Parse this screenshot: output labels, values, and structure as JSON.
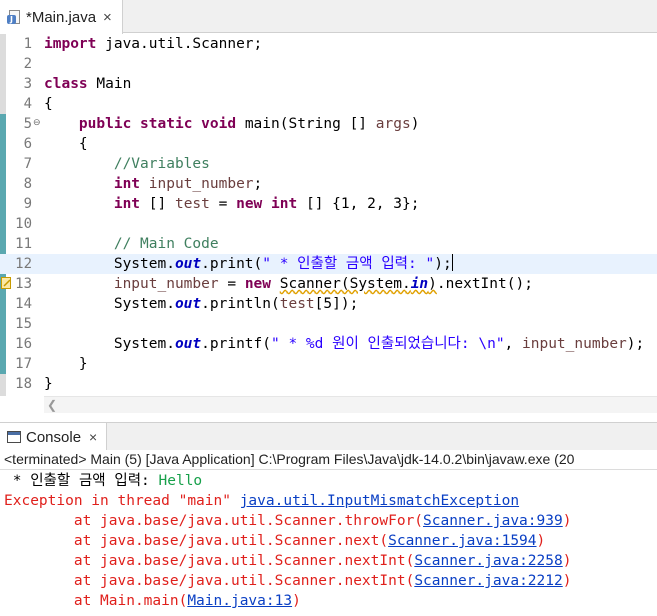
{
  "editor_tab": {
    "label": "*Main.java",
    "close": "×",
    "icon": "java-file-icon"
  },
  "code_lines": [
    {
      "num": "1",
      "parts": [
        {
          "t": "import",
          "c": "kw"
        },
        {
          "t": " java.util.Scanner;",
          "c": ""
        }
      ]
    },
    {
      "num": "2",
      "parts": []
    },
    {
      "num": "3",
      "parts": [
        {
          "t": "class",
          "c": "kw"
        },
        {
          "t": " Main",
          "c": ""
        }
      ]
    },
    {
      "num": "4",
      "parts": [
        {
          "t": "{",
          "c": ""
        }
      ]
    },
    {
      "num": "5",
      "parts": [
        {
          "t": "    ",
          "c": ""
        },
        {
          "t": "public",
          "c": "kw"
        },
        {
          "t": " ",
          "c": ""
        },
        {
          "t": "static",
          "c": "kw"
        },
        {
          "t": " ",
          "c": ""
        },
        {
          "t": "void",
          "c": "kw"
        },
        {
          "t": " main(String [] ",
          "c": ""
        },
        {
          "t": "args",
          "c": "var"
        },
        {
          "t": ")",
          "c": ""
        }
      ]
    },
    {
      "num": "6",
      "parts": [
        {
          "t": "    {",
          "c": ""
        }
      ]
    },
    {
      "num": "7",
      "parts": [
        {
          "t": "        ",
          "c": ""
        },
        {
          "t": "//Variables",
          "c": "cm"
        }
      ]
    },
    {
      "num": "8",
      "parts": [
        {
          "t": "        ",
          "c": ""
        },
        {
          "t": "int",
          "c": "kw"
        },
        {
          "t": " ",
          "c": ""
        },
        {
          "t": "input_number",
          "c": "var"
        },
        {
          "t": ";",
          "c": ""
        }
      ]
    },
    {
      "num": "9",
      "parts": [
        {
          "t": "        ",
          "c": ""
        },
        {
          "t": "int",
          "c": "kw"
        },
        {
          "t": " [] ",
          "c": ""
        },
        {
          "t": "test",
          "c": "var"
        },
        {
          "t": " = ",
          "c": ""
        },
        {
          "t": "new",
          "c": "kw"
        },
        {
          "t": " ",
          "c": ""
        },
        {
          "t": "int",
          "c": "kw"
        },
        {
          "t": " [] {1, 2, 3};",
          "c": ""
        }
      ]
    },
    {
      "num": "10",
      "parts": []
    },
    {
      "num": "11",
      "parts": [
        {
          "t": "        ",
          "c": ""
        },
        {
          "t": "// Main Code",
          "c": "cm"
        }
      ]
    },
    {
      "num": "12",
      "parts": [
        {
          "t": "        System.",
          "c": ""
        },
        {
          "t": "out",
          "c": "fld"
        },
        {
          "t": ".print(",
          "c": ""
        },
        {
          "t": "\" * 인출할 금액 입력: \"",
          "c": "str"
        },
        {
          "t": ");",
          "c": ""
        }
      ]
    },
    {
      "num": "13",
      "parts": [
        {
          "t": "        ",
          "c": ""
        },
        {
          "t": "input_number",
          "c": "var"
        },
        {
          "t": " = ",
          "c": ""
        },
        {
          "t": "new",
          "c": "kw"
        },
        {
          "t": " ",
          "c": ""
        },
        {
          "t": "Scanner(System.",
          "c": "warn-under"
        },
        {
          "t": "in",
          "c": "fld warn-under"
        },
        {
          "t": ")",
          "c": "warn-under"
        },
        {
          "t": ".nextInt();",
          "c": ""
        }
      ]
    },
    {
      "num": "14",
      "parts": [
        {
          "t": "        System.",
          "c": ""
        },
        {
          "t": "out",
          "c": "fld"
        },
        {
          "t": ".println(",
          "c": ""
        },
        {
          "t": "test",
          "c": "var"
        },
        {
          "t": "[5]);",
          "c": ""
        }
      ]
    },
    {
      "num": "15",
      "parts": []
    },
    {
      "num": "16",
      "parts": [
        {
          "t": "        System.",
          "c": ""
        },
        {
          "t": "out",
          "c": "fld"
        },
        {
          "t": ".printf(",
          "c": ""
        },
        {
          "t": "\" * %d 원이 인출되었습니다: \\n\"",
          "c": "str"
        },
        {
          "t": ", ",
          "c": ""
        },
        {
          "t": "input_number",
          "c": "var"
        },
        {
          "t": ");",
          "c": ""
        }
      ]
    },
    {
      "num": "17",
      "parts": [
        {
          "t": "    }",
          "c": ""
        }
      ]
    },
    {
      "num": "18",
      "parts": [
        {
          "t": "}",
          "c": ""
        }
      ]
    }
  ],
  "console_tab": {
    "label": "Console",
    "close": "×",
    "icon": "console-icon"
  },
  "terminated_text": "<terminated> Main (5) [Java Application] C:\\Program Files\\Java\\jdk-14.0.2\\bin\\javaw.exe  (20",
  "console_lines": [
    {
      "parts": [
        {
          "t": " * 인출할 금액 입력: ",
          "c": "out"
        },
        {
          "t": "Hello",
          "c": "in"
        }
      ]
    },
    {
      "parts": [
        {
          "t": "Exception in thread \"main\" ",
          "c": "err"
        },
        {
          "t": "java.util.InputMismatchException",
          "c": "lnk"
        }
      ]
    },
    {
      "parts": [
        {
          "t": "\tat java.base/java.util.Scanner.throwFor(",
          "c": "err"
        },
        {
          "t": "Scanner.java:939",
          "c": "lnk"
        },
        {
          "t": ")",
          "c": "err"
        }
      ]
    },
    {
      "parts": [
        {
          "t": "\tat java.base/java.util.Scanner.next(",
          "c": "err"
        },
        {
          "t": "Scanner.java:1594",
          "c": "lnk"
        },
        {
          "t": ")",
          "c": "err"
        }
      ]
    },
    {
      "parts": [
        {
          "t": "\tat java.base/java.util.Scanner.nextInt(",
          "c": "err"
        },
        {
          "t": "Scanner.java:2258",
          "c": "lnk"
        },
        {
          "t": ")",
          "c": "err"
        }
      ]
    },
    {
      "parts": [
        {
          "t": "\tat java.base/java.util.Scanner.nextInt(",
          "c": "err"
        },
        {
          "t": "Scanner.java:2212",
          "c": "lnk"
        },
        {
          "t": ")",
          "c": "err"
        }
      ]
    },
    {
      "parts": [
        {
          "t": "\tat Main.main(",
          "c": "err"
        },
        {
          "t": "Main.java:13",
          "c": "lnk"
        },
        {
          "t": ")",
          "c": "err"
        }
      ]
    }
  ],
  "colors": {
    "keyword": "#7f0055",
    "comment": "#3f7f5f",
    "string": "#2a00ff",
    "error": "#e0201c",
    "link": "#0a3fc4",
    "input": "#17a04a"
  }
}
